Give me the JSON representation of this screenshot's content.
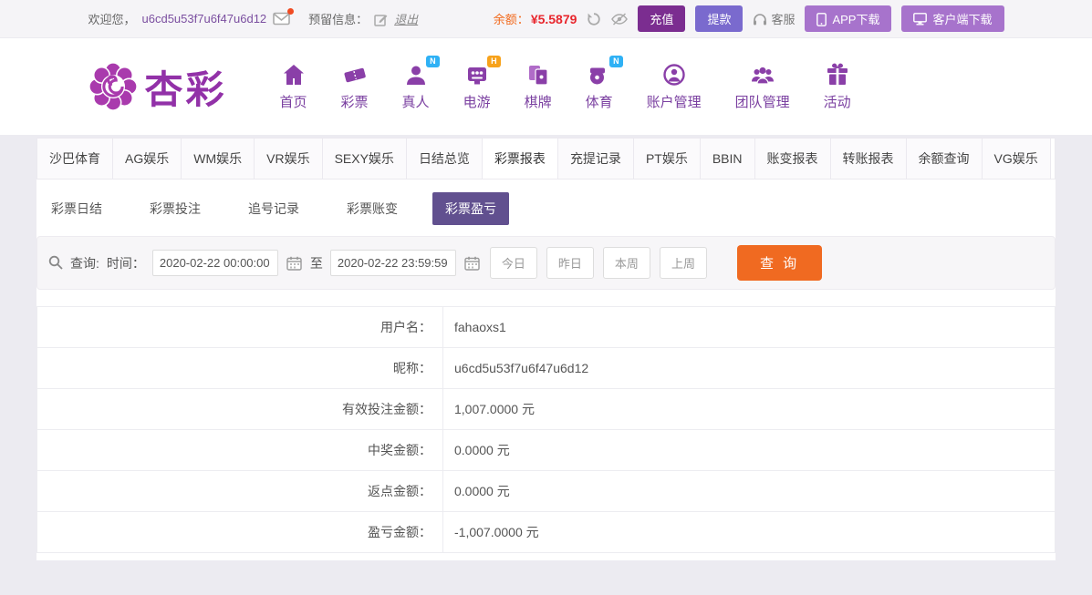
{
  "colors": {
    "brand_purple": "#8a3fa8",
    "accent_orange": "#f06a21",
    "balance_red": "#e8262d",
    "balance_label_orange": "#f2691c",
    "badge_blue": "#2fb1f5",
    "badge_orange": "#f7a21b",
    "subtab_active_bg": "#61508f",
    "recharge_btn_bg": "#7b2d90",
    "withdraw_btn_bg": "#7a6ace",
    "download_btn_bg": "#a773cc"
  },
  "icons": [
    "mail-icon",
    "edit-icon",
    "refresh-icon",
    "eye-off-icon",
    "headset-icon",
    "phone-icon",
    "monitor-icon",
    "search-icon",
    "calendar-icon",
    "home-icon",
    "lottery-ticket-icon",
    "live-person-icon",
    "egame-slot-icon",
    "chess-cards-icon",
    "sports-whistle-icon",
    "account-manage-icon",
    "team-manage-icon",
    "activity-gift-icon",
    "brand-flower-icon"
  ],
  "topbar": {
    "welcome": "欢迎您，",
    "username": "u6cd5u53f7u6f47u6d12",
    "reserved_label": "预留信息：",
    "logout": "退出",
    "balance_label": "余额：",
    "balance_value": "¥5.5879",
    "recharge": "充值",
    "withdraw": "提款",
    "service": "客服",
    "app_download": "APP下载",
    "client_download": "客户端下载"
  },
  "brand": {
    "name": "杏彩"
  },
  "nav": {
    "items": [
      {
        "label": "首页",
        "badge": ""
      },
      {
        "label": "彩票",
        "badge": ""
      },
      {
        "label": "真人",
        "badge": "N"
      },
      {
        "label": "电游",
        "badge": "H"
      },
      {
        "label": "棋牌",
        "badge": ""
      },
      {
        "label": "体育",
        "badge": "N"
      },
      {
        "label": "账户管理",
        "badge": ""
      },
      {
        "label": "团队管理",
        "badge": ""
      },
      {
        "label": "活动",
        "badge": ""
      }
    ]
  },
  "tabs": {
    "active": "彩票报表",
    "items": [
      "沙巴体育",
      "AG娱乐",
      "WM娱乐",
      "VR娱乐",
      "SEXY娱乐",
      "日结总览",
      "彩票报表",
      "充提记录",
      "PT娱乐",
      "BBIN",
      "账变报表",
      "转账报表",
      "余额查询",
      "VG娱乐"
    ]
  },
  "subtabs": {
    "active": "彩票盈亏",
    "items": [
      "彩票日结",
      "彩票投注",
      "追号记录",
      "彩票账变",
      "彩票盈亏"
    ]
  },
  "query": {
    "label": "查询:",
    "time_label": "时间：",
    "start": "2020-02-22 00:00:00",
    "to": "至",
    "end": "2020-02-22 23:59:59",
    "quick": [
      "今日",
      "昨日",
      "本周",
      "上周"
    ],
    "submit": "查 询"
  },
  "report": {
    "rows": [
      {
        "label": "用户名：",
        "value": "fahaoxs1"
      },
      {
        "label": "昵称：",
        "value": "u6cd5u53f7u6f47u6d12"
      },
      {
        "label": "有效投注金额：",
        "value": "1,007.0000 元"
      },
      {
        "label": "中奖金额：",
        "value": "0.0000 元"
      },
      {
        "label": "返点金额：",
        "value": "0.0000 元"
      },
      {
        "label": "盈亏金额：",
        "value": "-1,007.0000 元"
      }
    ]
  }
}
